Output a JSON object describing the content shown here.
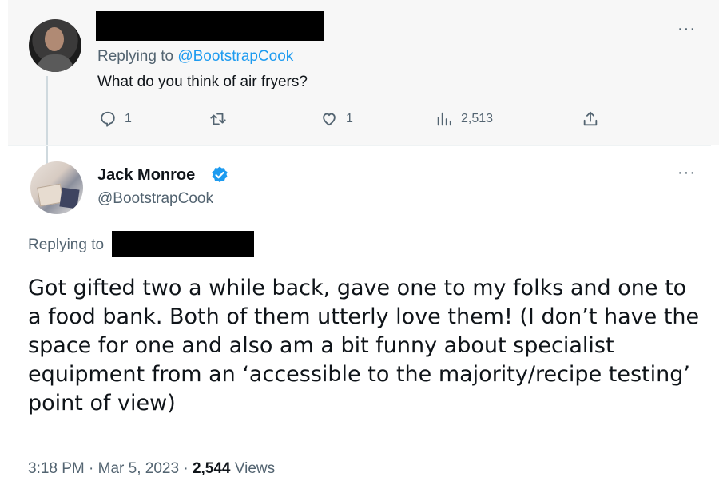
{
  "top_tweet": {
    "replying_prefix": "Replying to ",
    "replying_handle": "@BootstrapCook",
    "text": "What do you think of air fryers?",
    "more_label": "···",
    "actions": {
      "reply_count": "1",
      "like_count": "1",
      "views_count": "2,513"
    },
    "icons": [
      "reply-icon",
      "retweet-icon",
      "like-icon",
      "views-icon",
      "share-icon"
    ]
  },
  "main_tweet": {
    "author_name": "Jack Monroe",
    "author_handle": "@BootstrapCook",
    "more_label": "···",
    "replying_prefix": "Replying to",
    "body": "Got gifted two a while back, gave one to my folks and one to a food bank. Both of them utterly love them! (I don’t have the space for one and also am a bit funny about specialist equipment from an ‘accessible to the majority/recipe testing’ point of view)",
    "time": "3:18 PM",
    "date": "Mar 5, 2023",
    "views_count": "2,544",
    "views_label": "Views",
    "separator": " · "
  },
  "colors": {
    "link": "#1d9bf0",
    "secondary_text": "#536471",
    "top_tweet_bg": "#f7f7f7"
  }
}
